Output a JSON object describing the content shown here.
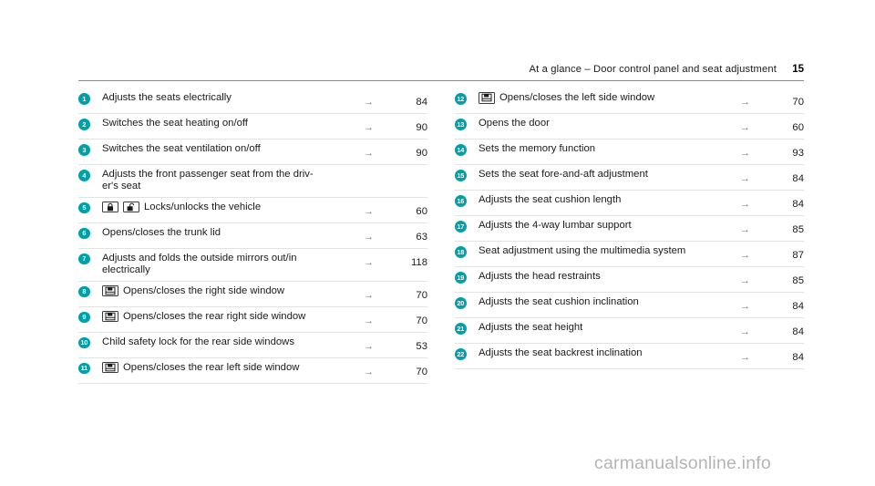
{
  "header": {
    "title": "At a glance – Door control panel and seat adjustment",
    "page_number": "15"
  },
  "colors": {
    "badge_teal": "#00a0a8",
    "rule_gray": "#8c8c8c",
    "row_divider": "#e2e2e2",
    "watermark_gray": "#b4b4b4"
  },
  "arrow_glyph": "→",
  "left_column": [
    {
      "badge": "1",
      "icons": [],
      "label": "Adjusts the seats electrically",
      "arrow": "→",
      "page": "84"
    },
    {
      "badge": "2",
      "icons": [],
      "label": "Switches the seat heating on/off",
      "arrow": "→",
      "page": "90"
    },
    {
      "badge": "3",
      "icons": [],
      "label": "Switches the seat ventilation on/off",
      "arrow": "→",
      "page": "90"
    },
    {
      "badge": "4",
      "icons": [],
      "label": "Adjusts the front passenger seat from the driv-\ner's seat",
      "arrow": "",
      "page": ""
    },
    {
      "badge": "5",
      "icons": [
        "lock-closed-icon",
        "lock-open-icon"
      ],
      "label": "Locks/unlocks the vehicle",
      "arrow": "→",
      "page": "60"
    },
    {
      "badge": "6",
      "icons": [],
      "label": "Opens/closes the trunk lid",
      "arrow": "→",
      "page": "63"
    },
    {
      "badge": "7",
      "icons": [],
      "label": "Adjusts and folds the outside mirrors out/in\nelectrically",
      "arrow": "→",
      "page": "118"
    },
    {
      "badge": "8",
      "icons": [
        "side-window-icon"
      ],
      "label": "Opens/closes the right side window",
      "arrow": "→",
      "page": "70"
    },
    {
      "badge": "9",
      "icons": [
        "side-window-icon"
      ],
      "label": "Opens/closes the rear right side window",
      "arrow": "→",
      "page": "70"
    },
    {
      "badge": "10",
      "icons": [],
      "label": "Child safety lock for the rear side windows",
      "arrow": "→",
      "page": "53"
    },
    {
      "badge": "11",
      "icons": [
        "side-window-icon"
      ],
      "label": "Opens/closes the rear left side window",
      "arrow": "→",
      "page": "70"
    }
  ],
  "right_column": [
    {
      "badge": "12",
      "icons": [
        "side-window-icon"
      ],
      "label": "Opens/closes the left side window",
      "arrow": "→",
      "page": "70"
    },
    {
      "badge": "13",
      "icons": [],
      "label": "Opens the door",
      "arrow": "→",
      "page": "60"
    },
    {
      "badge": "14",
      "icons": [],
      "label": "Sets the memory function",
      "arrow": "→",
      "page": "93"
    },
    {
      "badge": "15",
      "icons": [],
      "label": "Sets the seat fore-and-aft adjustment",
      "arrow": "→",
      "page": "84"
    },
    {
      "badge": "16",
      "icons": [],
      "label": "Adjusts the seat cushion length",
      "arrow": "→",
      "page": "84"
    },
    {
      "badge": "17",
      "icons": [],
      "label": "Adjusts the 4-way lumbar support",
      "arrow": "→",
      "page": "85"
    },
    {
      "badge": "18",
      "icons": [],
      "label": "Seat adjustment using the multimedia system",
      "arrow": "→",
      "page": "87"
    },
    {
      "badge": "19",
      "icons": [],
      "label": "Adjusts the head restraints",
      "arrow": "→",
      "page": "85"
    },
    {
      "badge": "20",
      "icons": [],
      "label": "Adjusts the seat cushion inclination",
      "arrow": "→",
      "page": "84"
    },
    {
      "badge": "21",
      "icons": [],
      "label": "Adjusts the seat height",
      "arrow": "→",
      "page": "84"
    },
    {
      "badge": "22",
      "icons": [],
      "label": "Adjusts the seat backrest inclination",
      "arrow": "→",
      "page": "84"
    }
  ],
  "watermark": "carmanualsonline.info"
}
